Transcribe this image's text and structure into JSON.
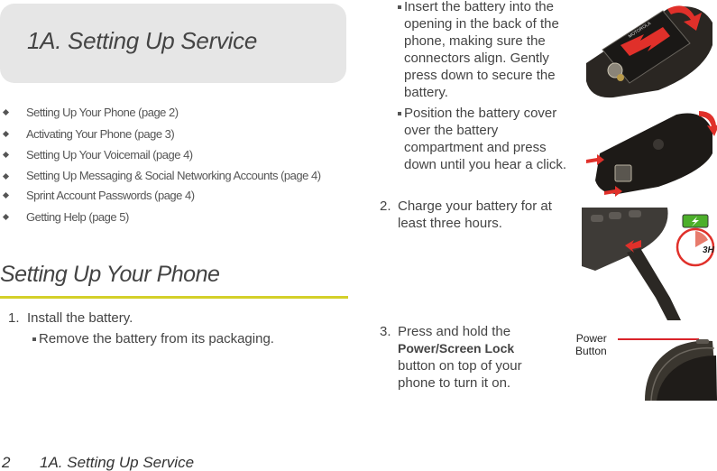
{
  "chapter": {
    "title": "1A.  Setting Up Service"
  },
  "toc": {
    "items": [
      {
        "label": "Setting Up Your Phone (page 2)"
      },
      {
        "label": "Activating Your Phone (page 3)"
      },
      {
        "label": "Setting Up Your Voicemail (page 4)"
      },
      {
        "label": "Setting Up Messaging & Social Networking Accounts (page 4)"
      },
      {
        "label": "Sprint Account Passwords (page 4)"
      },
      {
        "label": "Getting Help (page 5)"
      }
    ]
  },
  "section": {
    "title": "Setting Up Your Phone"
  },
  "steps": [
    {
      "number": "1.",
      "text": "Install the battery.",
      "substeps": [
        {
          "text": "Remove the battery from its packaging."
        },
        {
          "text": "Insert the battery into the opening in the back of the phone, making sure the connectors align. Gently press down to secure the battery."
        },
        {
          "text": "Position the battery cover over the battery compartment and press down until you hear a click."
        }
      ]
    },
    {
      "number": "2.",
      "text": "Charge your battery for at least three hours."
    },
    {
      "number": "3.",
      "text_before": "Press and hold the",
      "bold": "Power/Screen Lock",
      "text_after": "button on top of your phone to turn it on."
    }
  ],
  "figures": {
    "charge_label": "3H",
    "power_label_line1": "Power",
    "power_label_line2": "Button",
    "brand": "MOTOROLA"
  },
  "colors": {
    "accent_rule": "#d4d02a",
    "arrow_red": "#e0302a",
    "battery_green": "#4caf2a"
  },
  "footer": {
    "page_number": "2",
    "chapter": "1A. Setting Up Service"
  }
}
